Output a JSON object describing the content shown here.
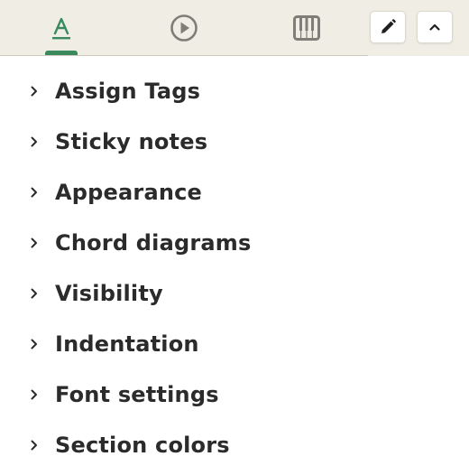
{
  "toolbar": {
    "tabs": [
      {
        "name": "text",
        "icon": "text-format-icon",
        "active": true
      },
      {
        "name": "play",
        "icon": "play-circle-icon",
        "active": false
      },
      {
        "name": "piano",
        "icon": "piano-keys-icon",
        "active": false
      }
    ],
    "edit_icon": "pencil-icon",
    "collapse_icon": "chevron-up-icon",
    "accent_color": "#3b8a5e"
  },
  "menu": {
    "items": [
      {
        "label": "Assign Tags"
      },
      {
        "label": "Sticky notes"
      },
      {
        "label": "Appearance"
      },
      {
        "label": "Chord diagrams"
      },
      {
        "label": "Visibility"
      },
      {
        "label": "Indentation"
      },
      {
        "label": "Font settings"
      },
      {
        "label": "Section colors"
      }
    ],
    "item_icon": "chevron-right-icon"
  }
}
